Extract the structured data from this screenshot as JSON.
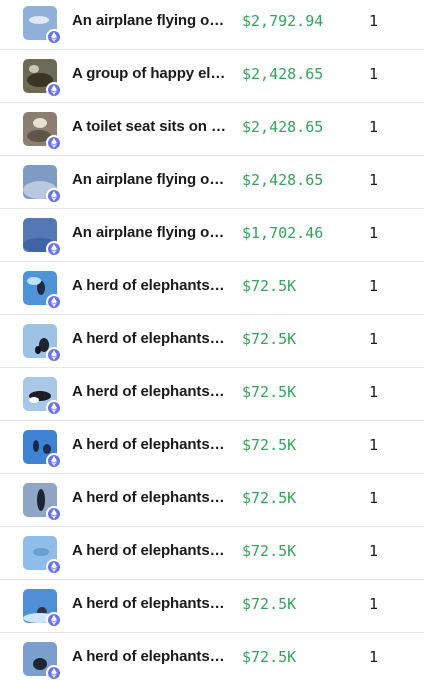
{
  "items": [
    {
      "name": "An airplane flying over the ocean",
      "price": "$2,792.94",
      "quantity": "1",
      "thumb_color": "#8fb0d8",
      "icon": "ethereum-icon"
    },
    {
      "name": "A group of happy elephants",
      "price": "$2,428.65",
      "quantity": "1",
      "thumb_color": "#6b6a55",
      "icon": "ethereum-icon"
    },
    {
      "name": "A toilet seat sits on the floor",
      "price": "$2,428.65",
      "quantity": "1",
      "thumb_color": "#8a7f70",
      "icon": "ethereum-icon"
    },
    {
      "name": "An airplane flying over the ocean",
      "price": "$2,428.65",
      "quantity": "1",
      "thumb_color": "#7f9cc4",
      "icon": "ethereum-icon"
    },
    {
      "name": "An airplane flying over the ocean",
      "price": "$1,702.46",
      "quantity": "1",
      "thumb_color": "#5579b6",
      "icon": "ethereum-icon"
    },
    {
      "name": "A herd of elephants walking",
      "price": "$72.5K",
      "quantity": "1",
      "thumb_color": "#4f94d8",
      "icon": "ethereum-icon"
    },
    {
      "name": "A herd of elephants walking",
      "price": "$72.5K",
      "quantity": "1",
      "thumb_color": "#9ec2e4",
      "icon": "ethereum-icon"
    },
    {
      "name": "A herd of elephants walking",
      "price": "$72.5K",
      "quantity": "1",
      "thumb_color": "#a9c8e6",
      "icon": "ethereum-icon"
    },
    {
      "name": "A herd of elephants walking",
      "price": "$72.5K",
      "quantity": "1",
      "thumb_color": "#3f84d4",
      "icon": "ethereum-icon"
    },
    {
      "name": "A herd of elephants walking",
      "price": "$72.5K",
      "quantity": "1",
      "thumb_color": "#8fa7c4",
      "icon": "ethereum-icon"
    },
    {
      "name": "A herd of elephants walking",
      "price": "$72.5K",
      "quantity": "1",
      "thumb_color": "#8dbde8",
      "icon": "ethereum-icon"
    },
    {
      "name": "A herd of elephants walking",
      "price": "$72.5K",
      "quantity": "1",
      "thumb_color": "#4f8fd6",
      "icon": "ethereum-icon"
    },
    {
      "name": "A herd of elephants walking",
      "price": "$72.5K",
      "quantity": "1",
      "thumb_color": "#7a9fce",
      "icon": "ethereum-icon"
    }
  ]
}
